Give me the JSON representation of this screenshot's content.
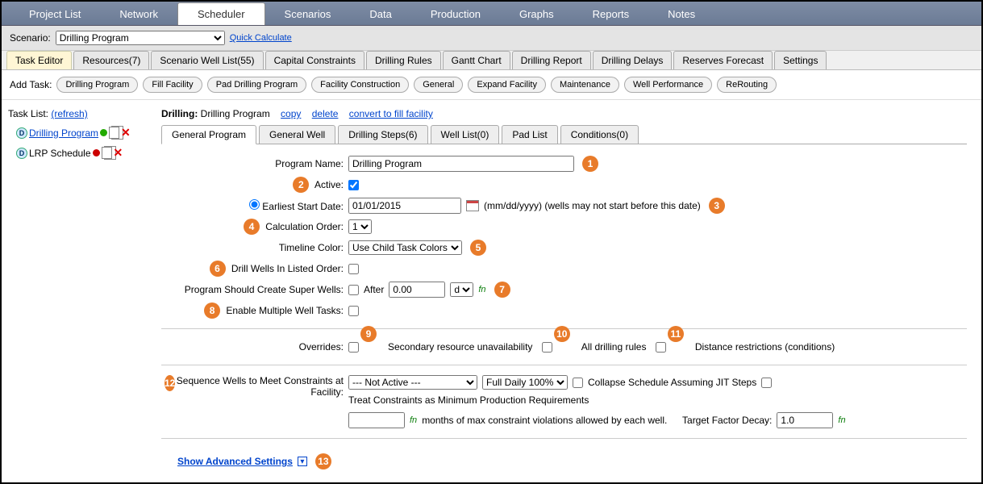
{
  "top_nav": [
    "Project List",
    "Network",
    "Scheduler",
    "Scenarios",
    "Data",
    "Production",
    "Graphs",
    "Reports",
    "Notes"
  ],
  "top_nav_active": 2,
  "scenario": {
    "label": "Scenario:",
    "value": "Drilling Program",
    "quick_calc": "Quick Calculate"
  },
  "sub_tabs": [
    "Task Editor",
    "Resources(7)",
    "Scenario Well List(55)",
    "Capital Constraints",
    "Drilling Rules",
    "Gantt Chart",
    "Drilling Report",
    "Drilling Delays",
    "Reserves Forecast",
    "Settings"
  ],
  "sub_tab_active": 0,
  "add_task": {
    "label": "Add Task:",
    "buttons": [
      "Drilling Program",
      "Fill Facility",
      "Pad Drilling Program",
      "Facility Construction",
      "General",
      "Expand Facility",
      "Maintenance",
      "Well Performance",
      "ReRouting"
    ]
  },
  "task_list": {
    "label": "Task List:",
    "refresh": "(refresh)",
    "items": [
      {
        "name": "Drilling Program",
        "active": true
      },
      {
        "name": "LRP Schedule",
        "active": false
      }
    ]
  },
  "editor": {
    "prefix": "Drilling:",
    "title": "Drilling Program",
    "links": [
      "copy",
      "delete",
      "convert to fill facility"
    ]
  },
  "inner_tabs": [
    "General Program",
    "General Well",
    "Drilling Steps(6)",
    "Well List(0)",
    "Pad List",
    "Conditions(0)"
  ],
  "inner_tab_active": 0,
  "form": {
    "program_name": {
      "label": "Program Name:",
      "value": "Drilling Program"
    },
    "active": {
      "label": "Active:",
      "checked": true
    },
    "earliest_start": {
      "label": "Earliest Start Date:",
      "value": "01/01/2015",
      "hint": "(mm/dd/yyyy) (wells may not start before this date)"
    },
    "calc_order": {
      "label": "Calculation Order:",
      "value": "1"
    },
    "timeline_color": {
      "label": "Timeline Color:",
      "value": "Use Child Task Colors"
    },
    "listed_order": {
      "label": "Drill Wells In Listed Order:",
      "checked": false
    },
    "super_wells": {
      "label": "Program Should Create Super Wells:",
      "after": "After",
      "value": "0.00",
      "unit": "d"
    },
    "multiple_well": {
      "label": "Enable Multiple Well Tasks:",
      "checked": false
    },
    "overrides": {
      "label": "Overrides:",
      "opts": [
        "Secondary resource unavailability",
        "All drilling rules",
        "Distance restrictions (conditions)"
      ]
    },
    "sequence": {
      "label": "Sequence Wells to Meet Constraints at Facility:",
      "sel1": "--- Not Active ---",
      "sel2": "Full Daily 100%",
      "jit": "Collapse Schedule Assuming JIT Steps",
      "treat": "Treat Constraints as Minimum Production Requirements",
      "months_hint": "months of max constraint violations allowed by each well.",
      "decay_label": "Target Factor Decay:",
      "decay_value": "1.0"
    },
    "advanced": "Show Advanced Settings"
  },
  "badges": [
    "1",
    "2",
    "3",
    "4",
    "5",
    "6",
    "7",
    "8",
    "9",
    "10",
    "11",
    "12",
    "13"
  ],
  "fn": "fn"
}
